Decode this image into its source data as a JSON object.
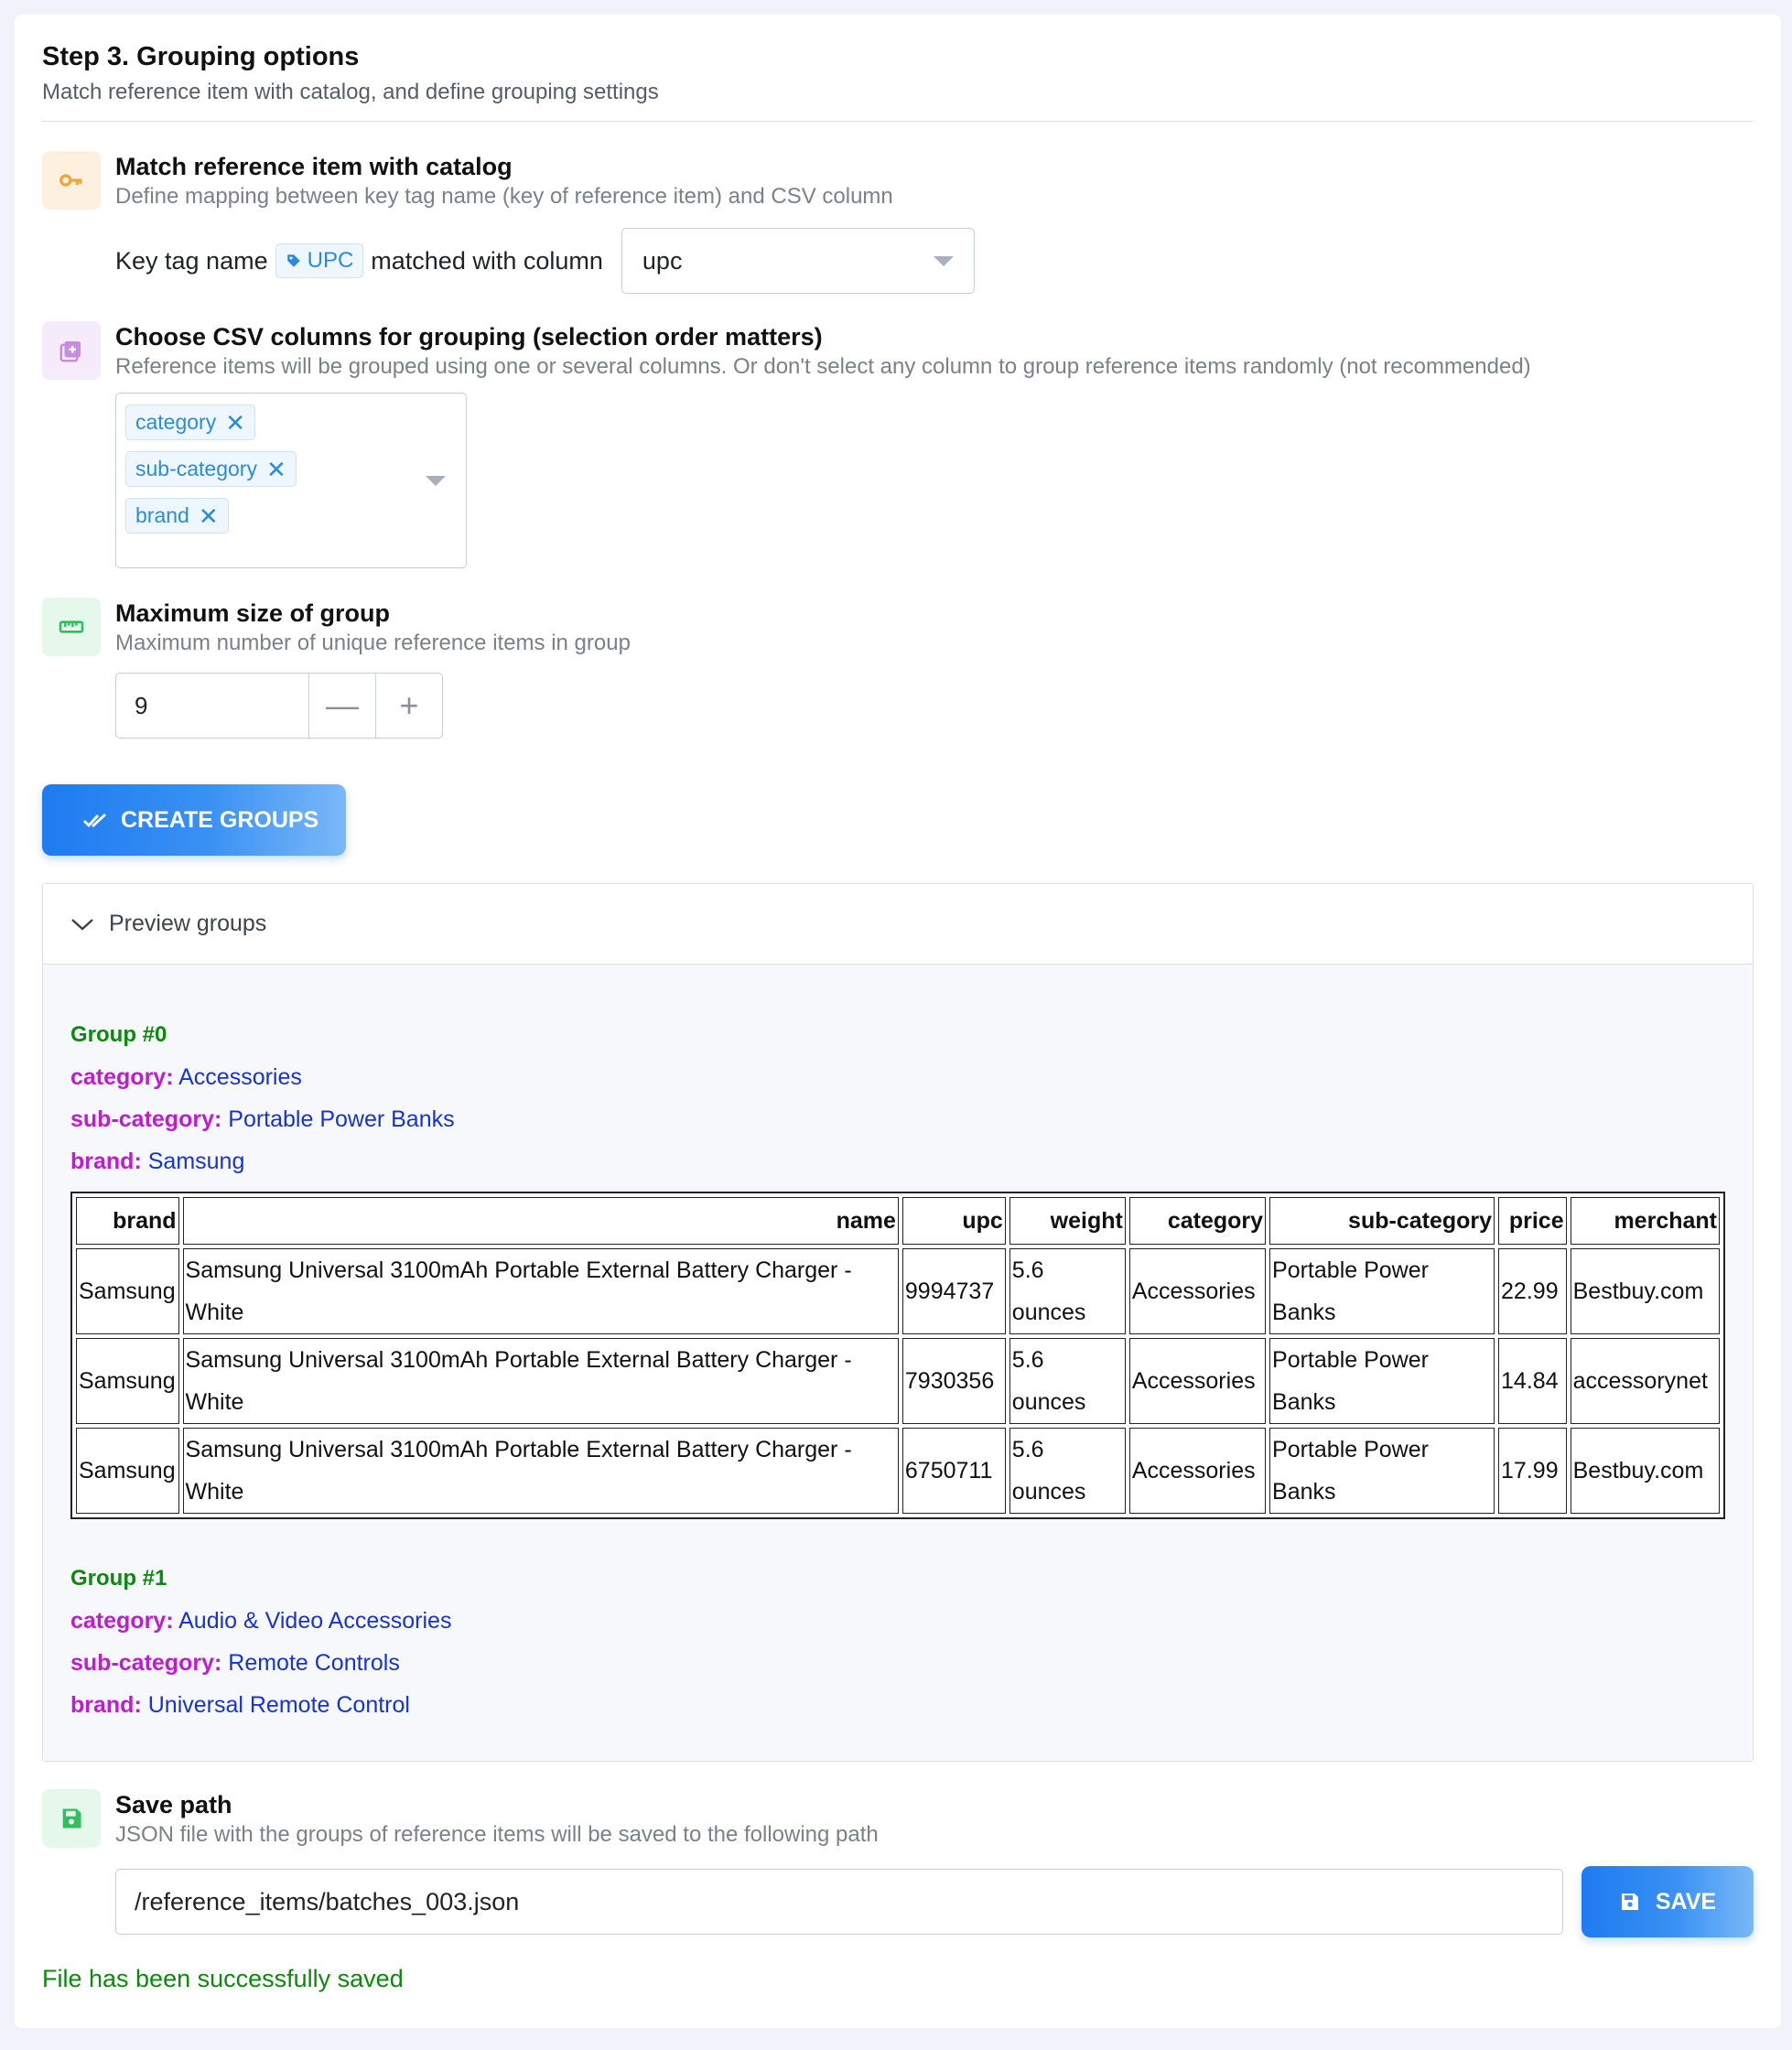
{
  "step": {
    "title": "Step 3. Grouping options",
    "subtitle": "Match reference item with catalog, and define grouping settings"
  },
  "match": {
    "icon": "key-icon",
    "title": "Match reference item with catalog",
    "subtitle": "Define mapping between key tag name (key of reference item) and CSV column",
    "key_label": "Key tag name",
    "tag": "UPC",
    "matched_label": "matched with column",
    "column": "upc"
  },
  "grouping": {
    "icon": "add-box-icon",
    "title": "Choose CSV columns for grouping (selection order matters)",
    "subtitle": "Reference items will be grouped using one or several columns. Or don't select any column to group reference items randomly (not recommended)",
    "chips": [
      "category",
      "sub-category",
      "brand"
    ]
  },
  "maxsize": {
    "icon": "ruler-icon",
    "title": "Maximum size of group",
    "subtitle": "Maximum number of unique reference items in group",
    "value": "9",
    "minus": "—",
    "plus": "+"
  },
  "create_button": "CREATE GROUPS",
  "preview": {
    "label": "Preview groups",
    "columns": [
      "brand",
      "name",
      "upc",
      "weight",
      "category",
      "sub-category",
      "price",
      "merchant"
    ],
    "groups": [
      {
        "title": "Group #0",
        "fields": [
          {
            "key": "category:",
            "value": "Accessories"
          },
          {
            "key": "sub-category:",
            "value": "Portable Power Banks"
          },
          {
            "key": "brand:",
            "value": "Samsung"
          }
        ],
        "rows": [
          [
            "Samsung",
            "Samsung Universal 3100mAh Portable External Battery Charger - White",
            "9994737",
            "5.6 ounces",
            "Accessories",
            "Portable Power Banks",
            "22.99",
            "Bestbuy.com"
          ],
          [
            "Samsung",
            "Samsung Universal 3100mAh Portable External Battery Charger - White",
            "7930356",
            "5.6 ounces",
            "Accessories",
            "Portable Power Banks",
            "14.84",
            "accessorynet"
          ],
          [
            "Samsung",
            "Samsung Universal 3100mAh Portable External Battery Charger - White",
            "6750711",
            "5.6 ounces",
            "Accessories",
            "Portable Power Banks",
            "17.99",
            "Bestbuy.com"
          ]
        ]
      },
      {
        "title": "Group #1",
        "fields": [
          {
            "key": "category:",
            "value": "Audio & Video Accessories"
          },
          {
            "key": "sub-category:",
            "value": "Remote Controls"
          },
          {
            "key": "brand:",
            "value": "Universal Remote Control"
          }
        ]
      }
    ]
  },
  "save": {
    "icon": "save-icon",
    "title": "Save path",
    "subtitle": "JSON file with the groups of reference items will be saved to the following path",
    "path": "/reference_items/batches_003.json",
    "button": "SAVE",
    "status": "File has been successfully saved"
  },
  "colors": {
    "accent": "#1e7bf0",
    "success": "#0b8a0b",
    "group_key": "#c21ad2",
    "group_value": "#1632d8"
  }
}
